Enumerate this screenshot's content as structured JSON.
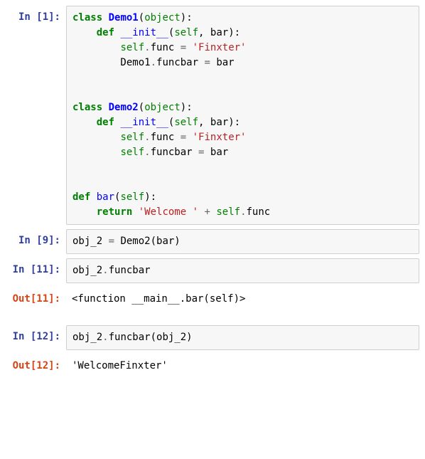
{
  "colors": {
    "prompt_in": "#303F9F",
    "prompt_out": "#D84315",
    "input_bg": "#f7f7f7",
    "border": "#cfcfcf"
  },
  "cells": [
    {
      "type": "in",
      "n": 1,
      "prompt": "In [1]:",
      "tokens": [
        {
          "cls": "k",
          "t": "class"
        },
        {
          "cls": "p",
          "t": " "
        },
        {
          "cls": "nc",
          "t": "Demo1"
        },
        {
          "cls": "p",
          "t": "("
        },
        {
          "cls": "bp",
          "t": "object"
        },
        {
          "cls": "p",
          "t": "):"
        },
        {
          "cls": "nl",
          "t": "\n"
        },
        {
          "cls": "p",
          "t": "    "
        },
        {
          "cls": "k",
          "t": "def"
        },
        {
          "cls": "p",
          "t": " "
        },
        {
          "cls": "nf",
          "t": "__init__"
        },
        {
          "cls": "p",
          "t": "("
        },
        {
          "cls": "bp",
          "t": "self"
        },
        {
          "cls": "p",
          "t": ", bar):"
        },
        {
          "cls": "nl",
          "t": "\n"
        },
        {
          "cls": "p",
          "t": "        "
        },
        {
          "cls": "bp",
          "t": "self"
        },
        {
          "cls": "o",
          "t": "."
        },
        {
          "cls": "n",
          "t": "func "
        },
        {
          "cls": "o",
          "t": "="
        },
        {
          "cls": "p",
          "t": " "
        },
        {
          "cls": "s",
          "t": "'Finxter'"
        },
        {
          "cls": "nl",
          "t": "\n"
        },
        {
          "cls": "p",
          "t": "        Demo1"
        },
        {
          "cls": "o",
          "t": "."
        },
        {
          "cls": "n",
          "t": "funcbar "
        },
        {
          "cls": "o",
          "t": "="
        },
        {
          "cls": "n",
          "t": " bar"
        },
        {
          "cls": "nl",
          "t": "\n"
        },
        {
          "cls": "nl",
          "t": "\n"
        },
        {
          "cls": "nl",
          "t": "\n"
        },
        {
          "cls": "k",
          "t": "class"
        },
        {
          "cls": "p",
          "t": " "
        },
        {
          "cls": "nc",
          "t": "Demo2"
        },
        {
          "cls": "p",
          "t": "("
        },
        {
          "cls": "bp",
          "t": "object"
        },
        {
          "cls": "p",
          "t": "):"
        },
        {
          "cls": "nl",
          "t": "\n"
        },
        {
          "cls": "p",
          "t": "    "
        },
        {
          "cls": "k",
          "t": "def"
        },
        {
          "cls": "p",
          "t": " "
        },
        {
          "cls": "nf",
          "t": "__init__"
        },
        {
          "cls": "p",
          "t": "("
        },
        {
          "cls": "bp",
          "t": "self"
        },
        {
          "cls": "p",
          "t": ", bar):"
        },
        {
          "cls": "nl",
          "t": "\n"
        },
        {
          "cls": "p",
          "t": "        "
        },
        {
          "cls": "bp",
          "t": "self"
        },
        {
          "cls": "o",
          "t": "."
        },
        {
          "cls": "n",
          "t": "func "
        },
        {
          "cls": "o",
          "t": "="
        },
        {
          "cls": "p",
          "t": " "
        },
        {
          "cls": "s",
          "t": "'Finxter'"
        },
        {
          "cls": "nl",
          "t": "\n"
        },
        {
          "cls": "p",
          "t": "        "
        },
        {
          "cls": "bp",
          "t": "self"
        },
        {
          "cls": "o",
          "t": "."
        },
        {
          "cls": "n",
          "t": "funcbar "
        },
        {
          "cls": "o",
          "t": "="
        },
        {
          "cls": "n",
          "t": " bar"
        },
        {
          "cls": "nl",
          "t": "\n"
        },
        {
          "cls": "nl",
          "t": "\n"
        },
        {
          "cls": "nl",
          "t": "\n"
        },
        {
          "cls": "k",
          "t": "def"
        },
        {
          "cls": "p",
          "t": " "
        },
        {
          "cls": "nf",
          "t": "bar"
        },
        {
          "cls": "p",
          "t": "("
        },
        {
          "cls": "bp",
          "t": "self"
        },
        {
          "cls": "p",
          "t": "):"
        },
        {
          "cls": "nl",
          "t": "\n"
        },
        {
          "cls": "p",
          "t": "    "
        },
        {
          "cls": "k",
          "t": "return"
        },
        {
          "cls": "p",
          "t": " "
        },
        {
          "cls": "s",
          "t": "'Welcome '"
        },
        {
          "cls": "p",
          "t": " "
        },
        {
          "cls": "o",
          "t": "+"
        },
        {
          "cls": "p",
          "t": " "
        },
        {
          "cls": "bp",
          "t": "self"
        },
        {
          "cls": "o",
          "t": "."
        },
        {
          "cls": "n",
          "t": "func"
        }
      ]
    },
    {
      "type": "in",
      "n": 9,
      "prompt": "In [9]:",
      "tokens": [
        {
          "cls": "n",
          "t": "obj_2 "
        },
        {
          "cls": "o",
          "t": "="
        },
        {
          "cls": "n",
          "t": " Demo2(bar)"
        }
      ]
    },
    {
      "type": "in",
      "n": 11,
      "prompt": "In [11]:",
      "tokens": [
        {
          "cls": "n",
          "t": "obj_2"
        },
        {
          "cls": "o",
          "t": "."
        },
        {
          "cls": "n",
          "t": "funcbar"
        }
      ]
    },
    {
      "type": "out",
      "n": 11,
      "prompt": "Out[11]:",
      "plain": "<function __main__.bar(self)>"
    },
    {
      "type": "in",
      "n": 12,
      "prompt": "In [12]:",
      "tokens": [
        {
          "cls": "n",
          "t": "obj_2"
        },
        {
          "cls": "o",
          "t": "."
        },
        {
          "cls": "n",
          "t": "funcbar(obj_2)"
        }
      ]
    },
    {
      "type": "out",
      "n": 12,
      "prompt": "Out[12]:",
      "plain": "'WelcomeFinxter'"
    }
  ]
}
